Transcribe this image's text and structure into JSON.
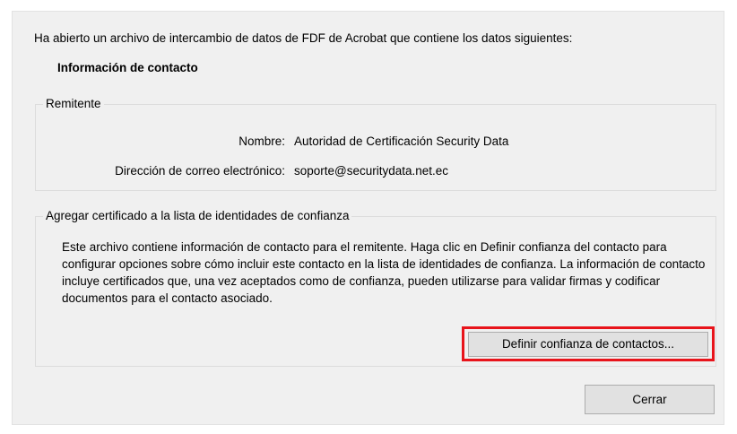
{
  "dialog": {
    "intro_text": "Ha abierto un archivo de intercambio de datos de FDF de Acrobat que contiene los datos siguientes:",
    "section_title": "Información de contacto"
  },
  "sender_group": {
    "legend": "Remitente",
    "name_label": "Nombre:",
    "name_value": "Autoridad de Certificación Security Data",
    "email_label": "Dirección de correo electrónico:",
    "email_value": "soporte@securitydata.net.ec"
  },
  "trust_group": {
    "legend": "Agregar certificado a la lista de identidades de confianza",
    "description": "Este archivo contiene información de contacto para el remitente. Haga clic en Definir confianza del contacto para configurar opciones sobre cómo incluir este contacto en la lista de identidades de confianza. La información de contacto incluye certificados que, una vez aceptados como de confianza, pueden utilizarse para validar firmas y codificar documentos para el contacto asociado.",
    "set_trust_button": "Definir confianza de contactos..."
  },
  "footer": {
    "close_button": "Cerrar"
  },
  "colors": {
    "dialog_background": "#f0f0f0",
    "button_background": "#e1e1e1",
    "highlight_border": "#e8141b"
  }
}
